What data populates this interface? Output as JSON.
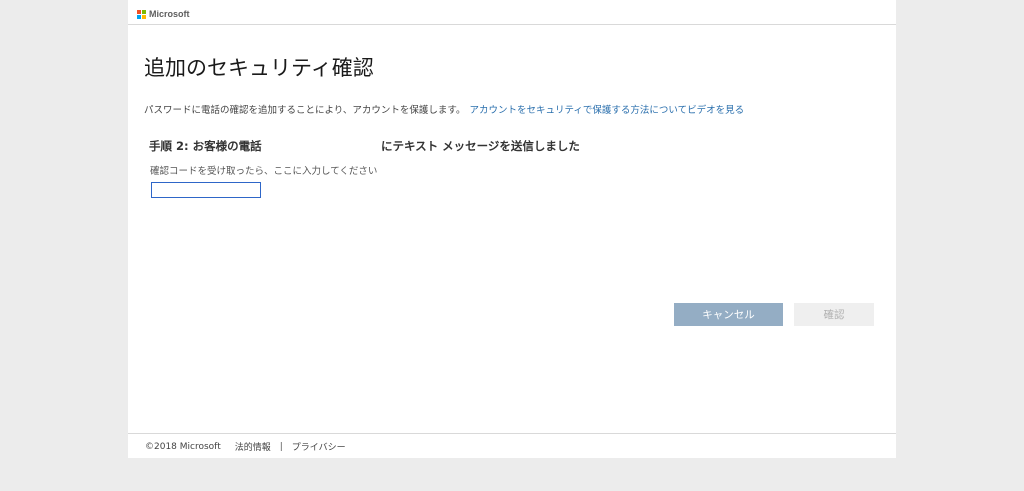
{
  "brand": {
    "name": "Microsoft",
    "logo_colors": [
      "#f25022",
      "#7fba00",
      "#00a4ef",
      "#ffb900"
    ]
  },
  "page": {
    "title": "追加のセキュリティ確認",
    "description": "パスワードに電話の確認を追加することにより、アカウントを保護します。",
    "description_link": "アカウントをセキュリティで保護する方法についてビデオを見る"
  },
  "step": {
    "label_part1": "手順 2: お客様の電話",
    "label_part2": "にテキスト メッセージを送信しました",
    "hint": "確認コードを受け取ったら、ここに入力してください",
    "code_value": ""
  },
  "buttons": {
    "cancel": "キャンセル",
    "confirm": "確認"
  },
  "footer": {
    "copyright": "©2018 Microsoft",
    "legal": "法的情報",
    "separator": "|",
    "privacy": "プライバシー"
  }
}
